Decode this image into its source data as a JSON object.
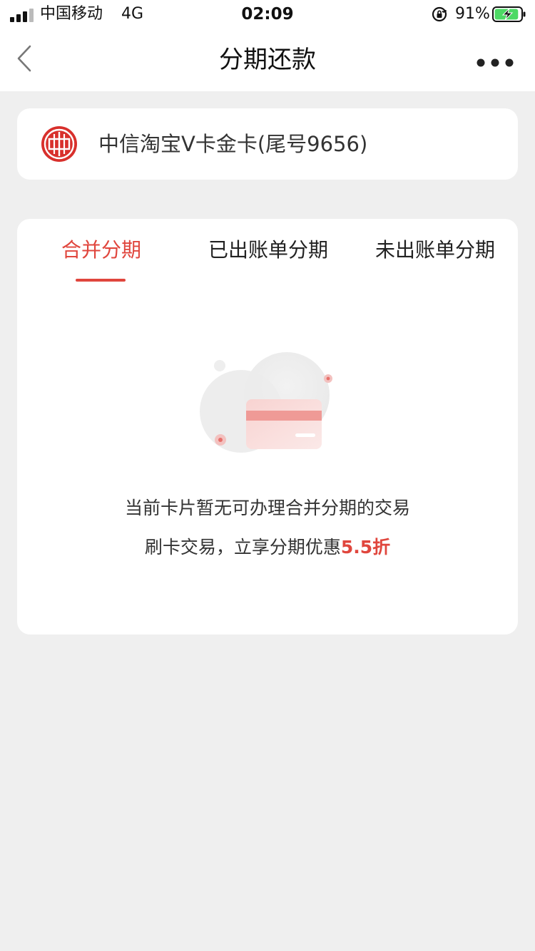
{
  "status_bar": {
    "carrier": "中国移动",
    "network": "4G",
    "time": "02:09",
    "battery_percent": "91%",
    "battery_level": 0.91,
    "icons": [
      "signal-icon",
      "orientation-lock-icon",
      "battery-charging-icon"
    ]
  },
  "nav": {
    "title": "分期还款",
    "back_icon": "chevron-left-icon",
    "more_icon": "more-dots-icon"
  },
  "card": {
    "name": "中信淘宝V卡金卡(尾号9656)",
    "logo_icon": "citic-bank-logo"
  },
  "tabs": [
    {
      "label": "合并分期",
      "active": true
    },
    {
      "label": "已出账单分期",
      "active": false
    },
    {
      "label": "未出账单分期",
      "active": false
    }
  ],
  "empty_state": {
    "message": "当前卡片暂无可办理合并分期的交易",
    "promo_prefix": "刷卡交易，立享分期优惠",
    "promo_highlight": "5.5折",
    "illustration_icon": "empty-card-illustration"
  },
  "colors": {
    "accent": "#e0463d",
    "background": "#efefef",
    "surface": "#ffffff",
    "battery_green": "#4cd964"
  }
}
